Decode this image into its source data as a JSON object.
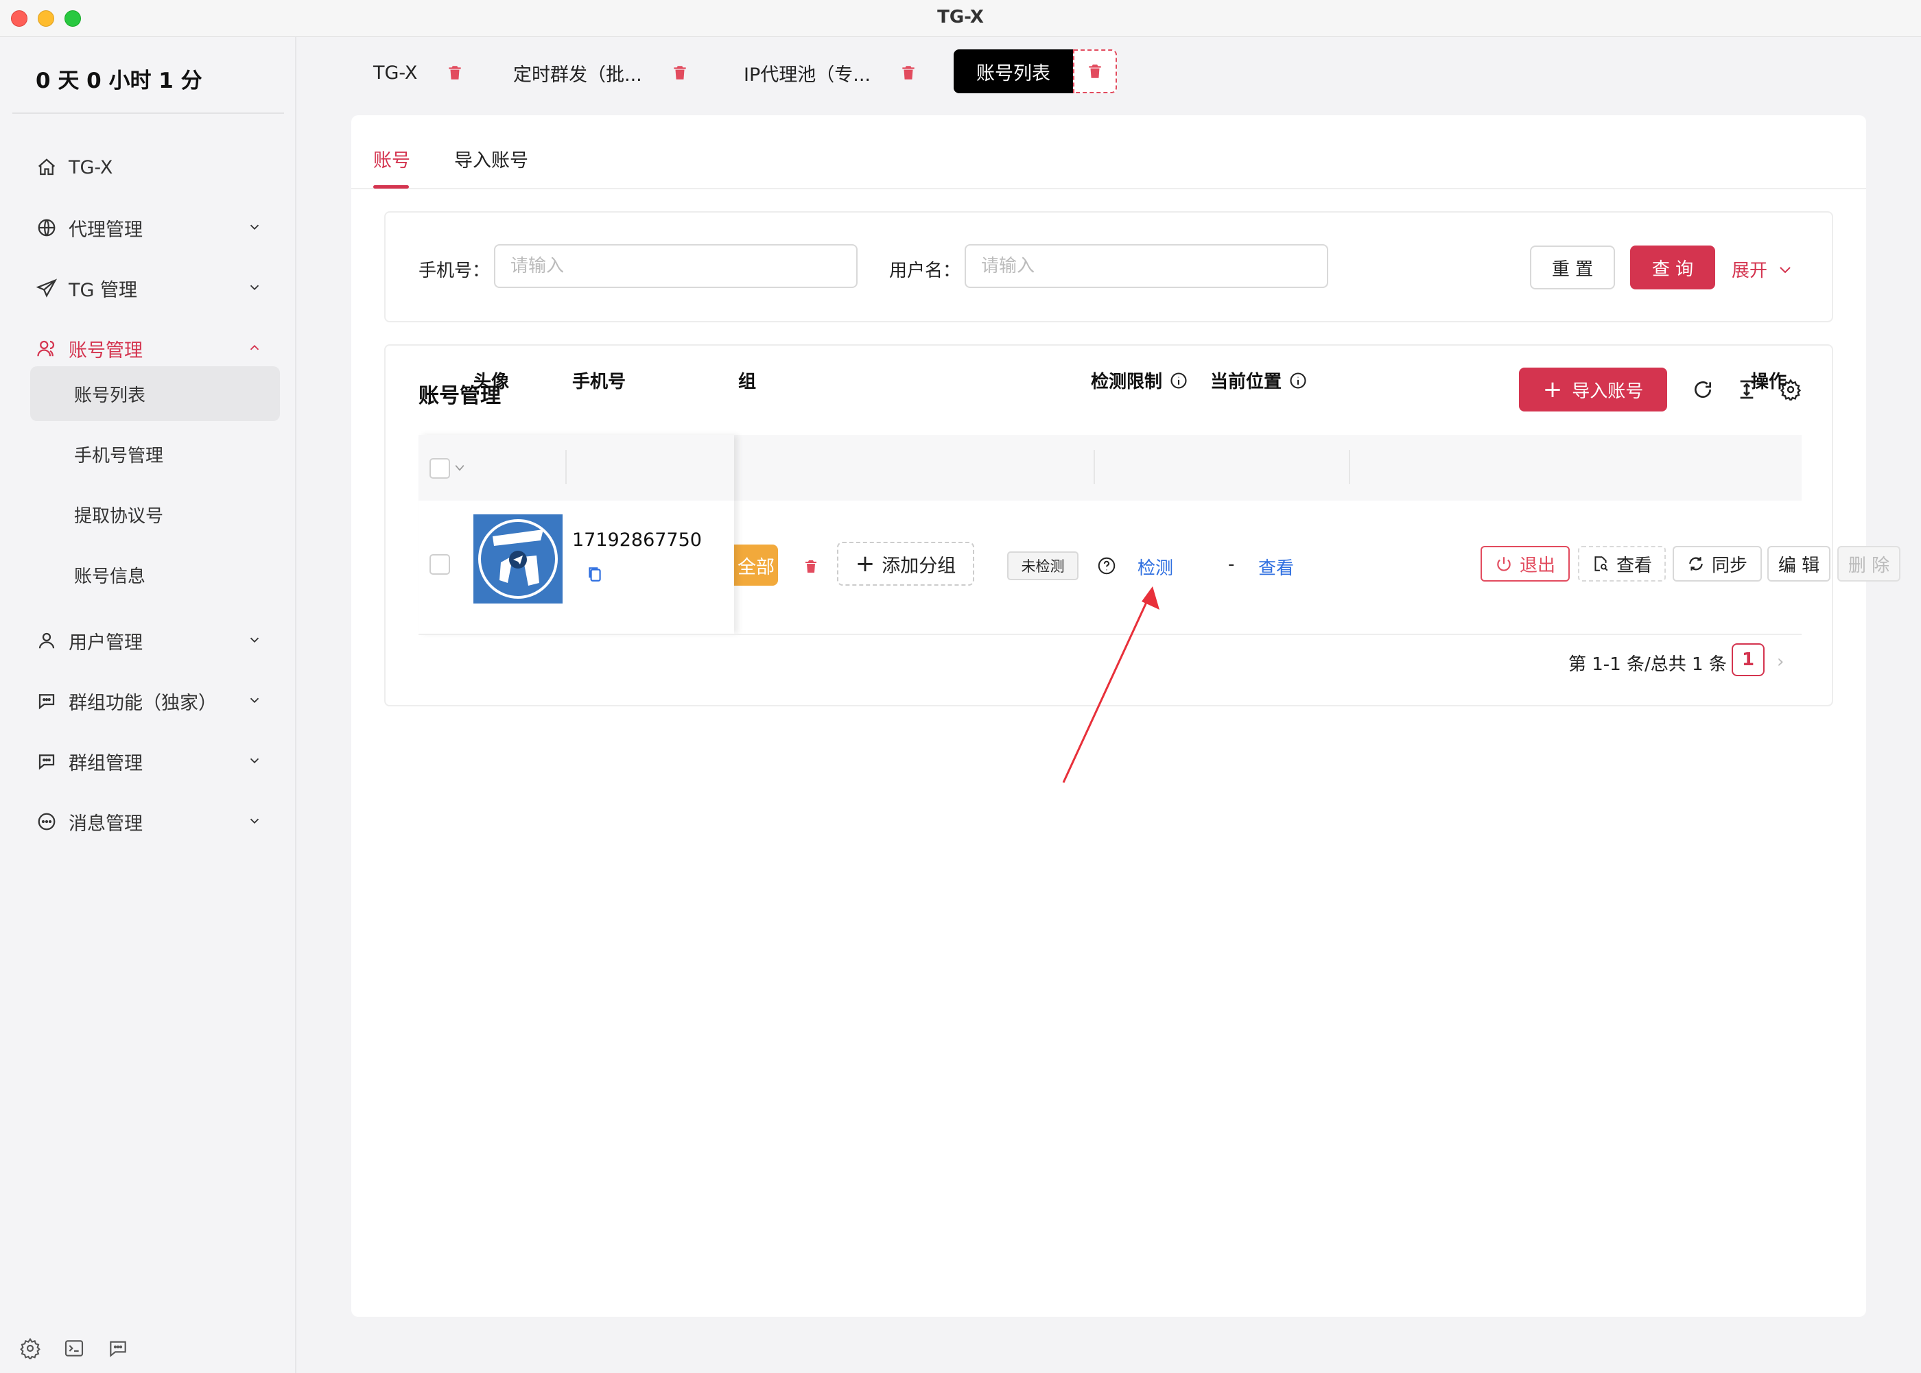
{
  "window": {
    "title": "TG-X"
  },
  "sidebar": {
    "timer": "0 天 0 小时 1 分",
    "items": [
      {
        "label": "TG-X",
        "icon": "home-icon"
      },
      {
        "label": "代理管理",
        "icon": "globe-icon"
      },
      {
        "label": "TG 管理",
        "icon": "send-icon"
      },
      {
        "label": "账号管理",
        "icon": "users-icon"
      },
      {
        "label": "用户管理",
        "icon": "user-icon"
      },
      {
        "label": "群组功能（独家）",
        "icon": "chat-icon"
      },
      {
        "label": "群组管理",
        "icon": "chat-icon"
      },
      {
        "label": "消息管理",
        "icon": "message-icon"
      }
    ],
    "subitems": [
      "账号列表",
      "手机号管理",
      "提取协议号",
      "账号信息"
    ]
  },
  "tabs": [
    {
      "label": "TG-X"
    },
    {
      "label": "定时群发（批..."
    },
    {
      "label": "IP代理池（专..."
    },
    {
      "label": "账号列表"
    }
  ],
  "subtabs": [
    "账号",
    "导入账号"
  ],
  "search": {
    "phone_label": "手机号：",
    "phone_placeholder": "请输入",
    "user_label": "用户名：",
    "user_placeholder": "请输入",
    "reset": "重 置",
    "query": "查 询",
    "expand": "展开"
  },
  "table": {
    "title": "账号管理",
    "import_button": "导入账号",
    "headers": [
      "头像",
      "手机号",
      "组",
      "检测限制",
      "当前位置",
      "操作"
    ],
    "row": {
      "phone": "17192867750",
      "group_tag": "全部",
      "add_group": "添加分组",
      "status": "未检测",
      "detect_link": "检测",
      "location": "-",
      "location_link": "查看",
      "actions": [
        "退出",
        "查看",
        "同步",
        "编 辑",
        "删 除"
      ]
    }
  },
  "pagination": {
    "summary": "第 1-1 条/总共 1 条",
    "current": "1"
  },
  "colors": {
    "accent": "#d4344f",
    "link": "#2f6fe0",
    "tag": "#f2a93b"
  }
}
